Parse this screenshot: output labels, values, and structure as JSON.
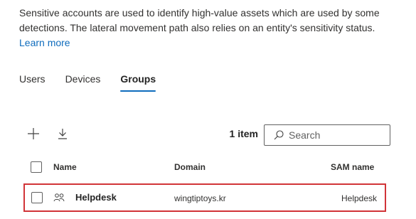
{
  "description": {
    "text": "Sensitive accounts are used to identify high-value assets which are used by some detections. The lateral movement path also relies on an entity's sensitivity status.",
    "learn_more": "Learn more"
  },
  "tabs": [
    {
      "label": "Users",
      "selected": false
    },
    {
      "label": "Devices",
      "selected": false
    },
    {
      "label": "Groups",
      "selected": true
    }
  ],
  "toolbar": {
    "add_icon": "add-icon",
    "download_icon": "download-icon",
    "count": "1 item",
    "search_placeholder": "Search",
    "search_icon": "search-icon"
  },
  "table": {
    "columns": [
      "Name",
      "Domain",
      "SAM name"
    ],
    "rows": [
      {
        "icon": "group-icon",
        "name": "Helpdesk",
        "domain": "wingtiptoys.kr",
        "sam_name": "Helpdesk"
      }
    ]
  },
  "colors": {
    "link": "#0f6cbd",
    "selected_tab_underline": "#0f6cbd",
    "highlight_border": "#d13438"
  }
}
